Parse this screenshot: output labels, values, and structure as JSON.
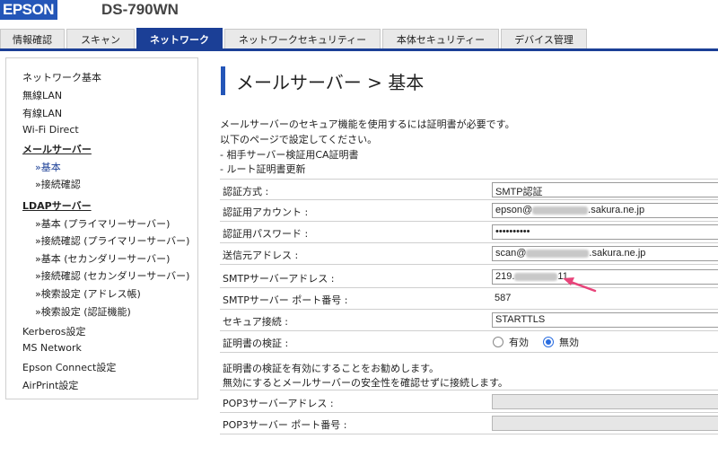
{
  "header": {
    "logo": "EPSON",
    "model": "DS-790WN"
  },
  "tabs": [
    {
      "label": "情報確認"
    },
    {
      "label": "スキャン"
    },
    {
      "label": "ネットワーク"
    },
    {
      "label": "ネットワークセキュリティー"
    },
    {
      "label": "本体セキュリティー"
    },
    {
      "label": "デバイス管理"
    }
  ],
  "sidebar": {
    "items": [
      "ネットワーク基本",
      "無線LAN",
      "有線LAN",
      "Wi-Fi Direct",
      "メールサーバー",
      "»基本",
      "»接続確認",
      "LDAPサーバー",
      "»基本 (プライマリーサーバー)",
      "»接続確認 (プライマリーサーバー)",
      "»基本 (セカンダリーサーバー)",
      "»接続確認 (セカンダリーサーバー)",
      "»検索設定 (アドレス帳)",
      "»検索設定 (認証機能)",
      "Kerberos設定",
      "MS Network",
      "Epson Connect設定",
      "AirPrint設定"
    ]
  },
  "page": {
    "title": "メールサーバー > 基本",
    "info": [
      "メールサーバーのセキュア機能を使用するには証明書が必要です。",
      "以下のページで設定してください。",
      "- 相手サーバー検証用CA証明書",
      "- ルート証明書更新"
    ]
  },
  "form": {
    "auth_method": {
      "label": "認証方式 :",
      "value": "SMTP認証"
    },
    "auth_account": {
      "label": "認証用アカウント :",
      "prefix": "epson@",
      "suffix": ".sakura.ne.jp"
    },
    "auth_password": {
      "label": "認証用パスワード :",
      "value": "••••••••••"
    },
    "sender_address": {
      "label": "送信元アドレス :",
      "prefix": "scan@",
      "suffix": ".sakura.ne.jp"
    },
    "smtp_server": {
      "label": "SMTPサーバーアドレス :",
      "prefix": "219.",
      "suffix": "11"
    },
    "smtp_port": {
      "label": "SMTPサーバー ポート番号 :",
      "value": "587"
    },
    "secure_connection": {
      "label": "セキュア接続 :",
      "value": "STARTTLS"
    },
    "cert_validation": {
      "label": "証明書の検証 :",
      "options": [
        "有効",
        "無効"
      ],
      "selected": "無効"
    },
    "notes": [
      "証明書の検証を有効にすることをお勧めします。",
      "無効にするとメールサーバーの安全性を確認せずに接続します。"
    ],
    "pop3_server": {
      "label": "POP3サーバーアドレス :",
      "value": ""
    },
    "pop3_port": {
      "label": "POP3サーバー ポート番号 :",
      "value": ""
    }
  },
  "colors": {
    "brand": "#2456b8",
    "active_tab": "#1b3f96",
    "annotation_arrow": "#e8447a"
  }
}
